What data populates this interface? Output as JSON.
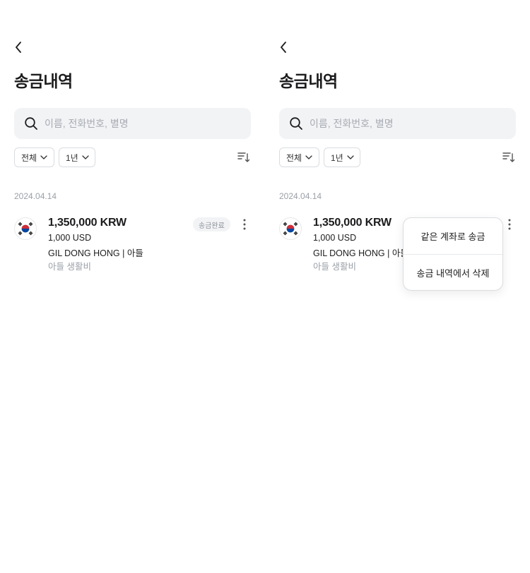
{
  "screens": [
    {
      "title": "송금내역",
      "search": {
        "placeholder": "이름, 전화번호, 별명",
        "value": ""
      },
      "filters": [
        {
          "label": "전체"
        },
        {
          "label": "1년"
        }
      ],
      "groups": [
        {
          "date": "2024.04.14",
          "items": [
            {
              "amount": "1,350,000 KRW",
              "converted": "1,000 USD",
              "recipient": "GIL DONG HONG | 아들",
              "memo": "아들 생활비",
              "status": "송금완료",
              "flag": "south-korea-flag-icon"
            }
          ]
        }
      ]
    },
    {
      "title": "송금내역",
      "search": {
        "placeholder": "이름, 전화번호, 별명",
        "value": ""
      },
      "filters": [
        {
          "label": "전체"
        },
        {
          "label": "1년"
        }
      ],
      "groups": [
        {
          "date": "2024.04.14",
          "items": [
            {
              "amount": "1,350,000 KRW",
              "converted": "1,000 USD",
              "recipient": "GIL DONG HONG | 아들",
              "memo": "아들 생활비",
              "flag": "south-korea-flag-icon"
            }
          ]
        }
      ],
      "context_menu": {
        "items": [
          {
            "label": "같은 계좌로 송금"
          },
          {
            "label": "송금 내역에서 삭제"
          }
        ]
      }
    }
  ],
  "icons": {
    "back": "chevron-left-icon",
    "search": "search-icon",
    "dropdown": "chevron-down-icon",
    "sort": "sort-icon",
    "more": "more-vertical-icon"
  },
  "colors": {
    "text_primary": "#1c1c1e",
    "text_secondary": "#9aa0a7",
    "surface": "#f2f3f5",
    "border": "#d9dce0",
    "flag_red": "#cd2e3a",
    "flag_blue": "#0047a0"
  }
}
